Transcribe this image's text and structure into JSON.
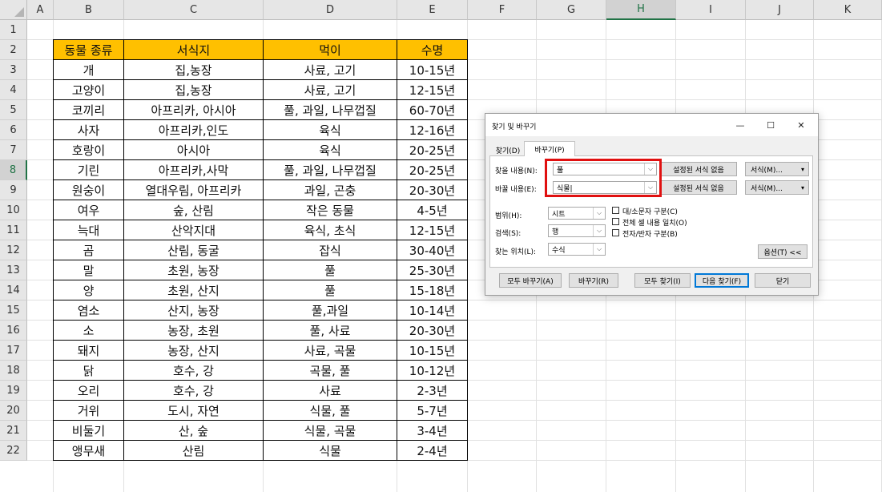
{
  "columns": [
    "A",
    "B",
    "C",
    "D",
    "E",
    "F",
    "G",
    "H",
    "I",
    "J",
    "K"
  ],
  "active_column": "H",
  "rows": [
    "1",
    "2",
    "3",
    "4",
    "5",
    "6",
    "7",
    "8",
    "9",
    "10",
    "11",
    "12",
    "13",
    "14",
    "15",
    "16",
    "17",
    "18",
    "19",
    "20",
    "21",
    "22"
  ],
  "active_row": "8",
  "table": {
    "headers": [
      "동물 종류",
      "서식지",
      "먹이",
      "수명"
    ],
    "rows": [
      [
        "개",
        "집,농장",
        "사료, 고기",
        "10-15년"
      ],
      [
        "고양이",
        "집,농장",
        "사료, 고기",
        "12-15년"
      ],
      [
        "코끼리",
        "아프리카, 아시아",
        "풀, 과일, 나무껍질",
        "60-70년"
      ],
      [
        "사자",
        "아프리카,인도",
        "육식",
        "12-16년"
      ],
      [
        "호랑이",
        "아시아",
        "육식",
        "20-25년"
      ],
      [
        "기린",
        "아프리카,사막",
        "풀, 과일, 나무껍질",
        "20-25년"
      ],
      [
        "원숭이",
        "열대우림, 아프리카",
        "과일, 곤충",
        "20-30년"
      ],
      [
        "여우",
        "숲, 산림",
        "작은 동물",
        "4-5년"
      ],
      [
        "늑대",
        "산악지대",
        "육식, 초식",
        "12-15년"
      ],
      [
        "곰",
        "산림, 동굴",
        "잡식",
        "30-40년"
      ],
      [
        "말",
        "초원, 농장",
        "풀",
        "25-30년"
      ],
      [
        "양",
        "초원, 산지",
        "풀",
        "15-18년"
      ],
      [
        "염소",
        "산지, 농장",
        "풀,과일",
        "10-14년"
      ],
      [
        "소",
        "농장, 초원",
        "풀, 사료",
        "20-30년"
      ],
      [
        "돼지",
        "농장, 산지",
        "사료, 곡물",
        "10-15년"
      ],
      [
        "닭",
        "호수, 강",
        "곡물, 풀",
        "10-12년"
      ],
      [
        "오리",
        "호수, 강",
        "사료",
        "2-3년"
      ],
      [
        "거위",
        "도시, 자연",
        "식물, 풀",
        "5-7년"
      ],
      [
        "비둘기",
        "산, 숲",
        "식물, 곡물",
        "3-4년"
      ],
      [
        "앵무새",
        "산림",
        "식물",
        "2-4년"
      ]
    ]
  },
  "dialog": {
    "title": "찾기 및 바꾸기",
    "minimize": "—",
    "maximize": "☐",
    "close": "✕",
    "tabs": [
      "찾기(D)",
      "바꾸기(P)"
    ],
    "find_label": "찾을 내용(N):",
    "find_value": "풀",
    "replace_label": "바꿀 내용(E):",
    "replace_value": "식물|",
    "format_none": "설정된 서식 없음",
    "format_btn": "서식(M)...",
    "within_label": "범위(H):",
    "within_value": "시트",
    "search_label": "검색(S):",
    "search_value": "행",
    "lookin_label": "찾는 위치(L):",
    "lookin_value": "수식",
    "match_case": "대/소문자 구분(C)",
    "match_entire": "전체 셀 내용 일치(O)",
    "match_byte": "전자/반자 구분(B)",
    "options_btn": "옵션(T) <<",
    "replace_all": "모두 바꾸기(A)",
    "replace_btn": "바꾸기(R)",
    "find_all": "모두 찾기(I)",
    "find_next": "다음 찾기(F)",
    "close_btn": "닫기",
    "dropdown_arrow": "⌵",
    "split_arrow": "▾"
  },
  "colors": {
    "header_fill": "#ffc000",
    "highlight": "#e01010",
    "excel_green": "#217346"
  }
}
